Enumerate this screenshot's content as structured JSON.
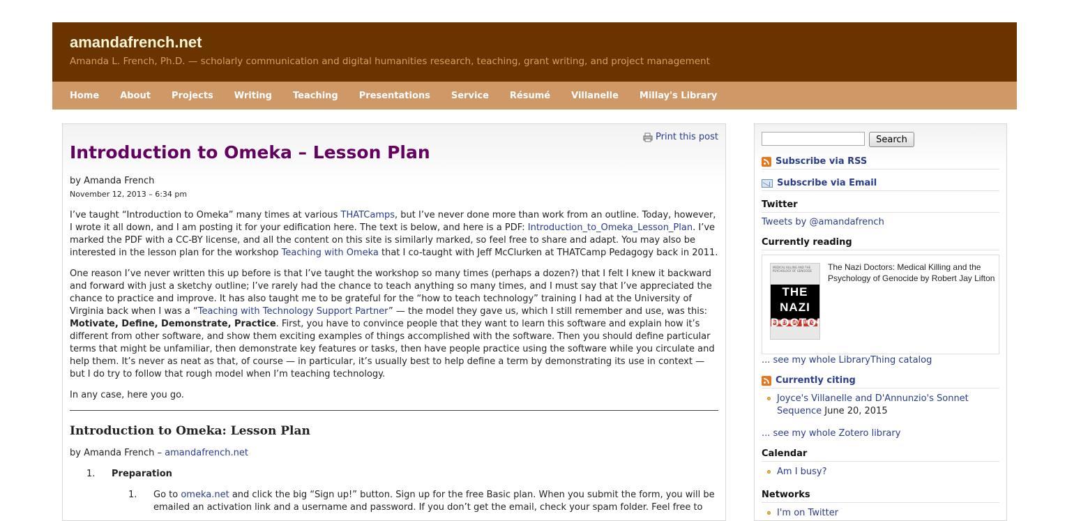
{
  "header": {
    "site_title": "amandafrench.net",
    "tagline": "Amanda L. French, Ph.D. — scholarly communication and digital humanities research, teaching, grant writing, and project management"
  },
  "nav": [
    {
      "label": "Home"
    },
    {
      "label": "About"
    },
    {
      "label": "Projects"
    },
    {
      "label": "Writing"
    },
    {
      "label": "Teaching"
    },
    {
      "label": "Presentations"
    },
    {
      "label": "Service"
    },
    {
      "label": "Résumé"
    },
    {
      "label": "Villanelle"
    },
    {
      "label": "Millay's Library"
    }
  ],
  "post": {
    "print_label": "Print this post",
    "title": "Introduction to Omeka – Lesson Plan",
    "byline": "by Amanda French",
    "date": "November 12, 2013 – 6:34 pm",
    "p1": {
      "t1": "I’ve taught “Introduction to Omeka” many times at various ",
      "link1": "THATCamps",
      "t2": ", but I’ve never done more than work from an outline. Today, however, I wrote it all down, and I am posting it for your edification here. The text is below, and here is a PDF: ",
      "link2": "Introduction_to_Omeka_Lesson_Plan",
      "t3": ". I’ve marked the PDF with a CC-BY license, and all the content on this site is similarly marked, so feel free to share and adapt. You may also be interested in the lesson plan for the workshop ",
      "link3": "Teaching with Omeka",
      "t4": " that I co-taught with Jeff McClurken at THATCamp Pedagogy back in 2011."
    },
    "p2": {
      "t1": "One reason I’ve never written this up before is that I’ve taught the workshop so many times (perhaps a dozen?) that I felt I knew it backward and forward with just a sketchy outline; I’ve rarely had the chance to teach anything so many times, and I must say that I’ve appreciated the chance to practice and improve. It has also taught me to be grateful for the “how to teach technology” training I had at the University of Virginia back when I was a “",
      "link1": "Teaching with Technology Support Partner",
      "t2": "” — the model they gave us, which I still remember and use, was this: ",
      "bold": "Motivate, Define, Demonstrate, Practice",
      "t3": ". First, you have to convince people that they want to learn this software and explain how it’s different from other software, and show them exciting examples of things accomplished with the software. Then you should define particular terms that might be unfamiliar, then demonstrate key features or tasks, then have people practice using the software while you circulate and help them. It’s never as neat as that, of course — in particular, it’s usually best to help define a term by demonstrating its use in context — but I do try to follow that rough model when I’m teaching technology."
    },
    "p3": "In any case, here you go.",
    "h2": "Introduction to Omeka: Lesson Plan",
    "byline2": {
      "text": "by Amanda French – ",
      "link": "amandafrench.net"
    },
    "list": {
      "n1": "1.",
      "item1": "Preparation",
      "sub_n1": "1.",
      "sub1": {
        "t1": "Go to ",
        "link": "omeka.net",
        "t2": " and click the big “Sign up!” button. Sign up for the free Basic plan. When you submit the form, you will be emailed an activation link and a username and password. If you don’t get the email, check your spam folder. Feel free to"
      }
    }
  },
  "sidebar": {
    "search_button": "Search",
    "search_placeholder": "",
    "subscribe_rss": "Subscribe via RSS",
    "subscribe_email": "Subscribe via Email",
    "twitter_title": "Twitter",
    "tweets_link": "Tweets by @amandafrench",
    "reading_title": "Currently reading",
    "book": {
      "title": "The Nazi Doctors: Medical Killing and the Psychology of Genocide by Robert Jay Lifton",
      "cover_top": "MEDICAL KILLING AND THE PSYCHOLOGY OF GENOCIDE",
      "cover_big": "THE NAZI DOCTORS",
      "cover_author": "ROBERT JAY LIFTON"
    },
    "librarything_link": "... see my whole LibraryThing catalog",
    "citing_title": "Currently citing",
    "citing_item_link": "Joyce's Villanelle and D'Annunzio's Sonnet Sequence",
    "citing_item_date": " June 20, 2015",
    "zotero_link": "... see my whole Zotero library",
    "calendar_title": "Calendar",
    "calendar_item": "Am I busy?",
    "networks_title": "Networks",
    "networks_item": "I'm on Twitter"
  }
}
